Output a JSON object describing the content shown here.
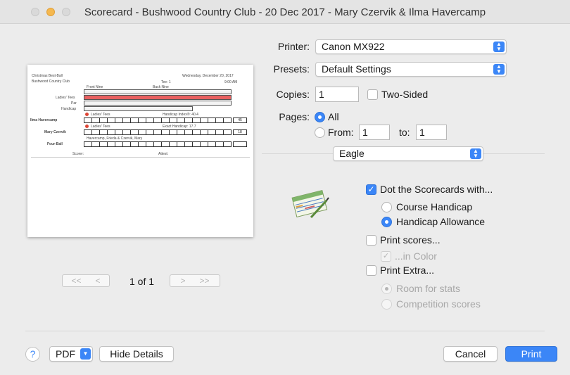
{
  "window": {
    "title": "Scorecard - Bushwood Country Club - 20 Dec 2017 - Mary Czervik & Ilma Havercamp"
  },
  "preview": {
    "event": "Christmas Best-Ball",
    "club": "Bushwood Country Club",
    "date": "Wednesday, December 20, 2017",
    "tee": "Tee: 1",
    "time": "9:00 AM",
    "front_nine": "Front Nine",
    "back_nine": "Back Nine",
    "rows": [
      "Ladies' Tees",
      "Par",
      "Handicap"
    ],
    "player1": "Ilma Havercamp",
    "player1_tees": "Ladies' Tees",
    "player1_handicap": "Handicap Index®: 40.4",
    "player1_score": "45",
    "player2": "Mary Czervik",
    "player2_tees": "Ladies' Tees",
    "player2_handicap": "Exact Handicap: 17.7",
    "player2_score": "18",
    "fourball_names": "Havercamp, Frieda & Czervik, Mary",
    "fourball": "Four-Ball",
    "scorer": "Scorer:",
    "attest": "Attest:"
  },
  "pager": {
    "first": "<<",
    "prev": "<",
    "page_label": "1 of 1",
    "next": ">",
    "last": ">>"
  },
  "form": {
    "printer_label": "Printer:",
    "printer_value": "Canon MX922",
    "presets_label": "Presets:",
    "presets_value": "Default Settings",
    "copies_label": "Copies:",
    "copies_value": "1",
    "two_sided": "Two-Sided",
    "pages_label": "Pages:",
    "pages_all": "All",
    "pages_from": "From:",
    "from_value": "1",
    "pages_to": "to:",
    "to_value": "1",
    "app_menu": "Eagle"
  },
  "options": {
    "dot_scorecards": "Dot the Scorecards with...",
    "course_handicap": "Course Handicap",
    "handicap_allowance": "Handicap Allowance",
    "print_scores": "Print scores...",
    "in_color": "...in Color",
    "print_extra": "Print Extra...",
    "room_for_stats": "Room for stats",
    "competition_scores": "Competition scores"
  },
  "footer": {
    "help": "?",
    "pdf": "PDF",
    "hide_details": "Hide Details",
    "cancel": "Cancel",
    "print": "Print"
  },
  "colors": {
    "accent": "#3b86f7"
  }
}
